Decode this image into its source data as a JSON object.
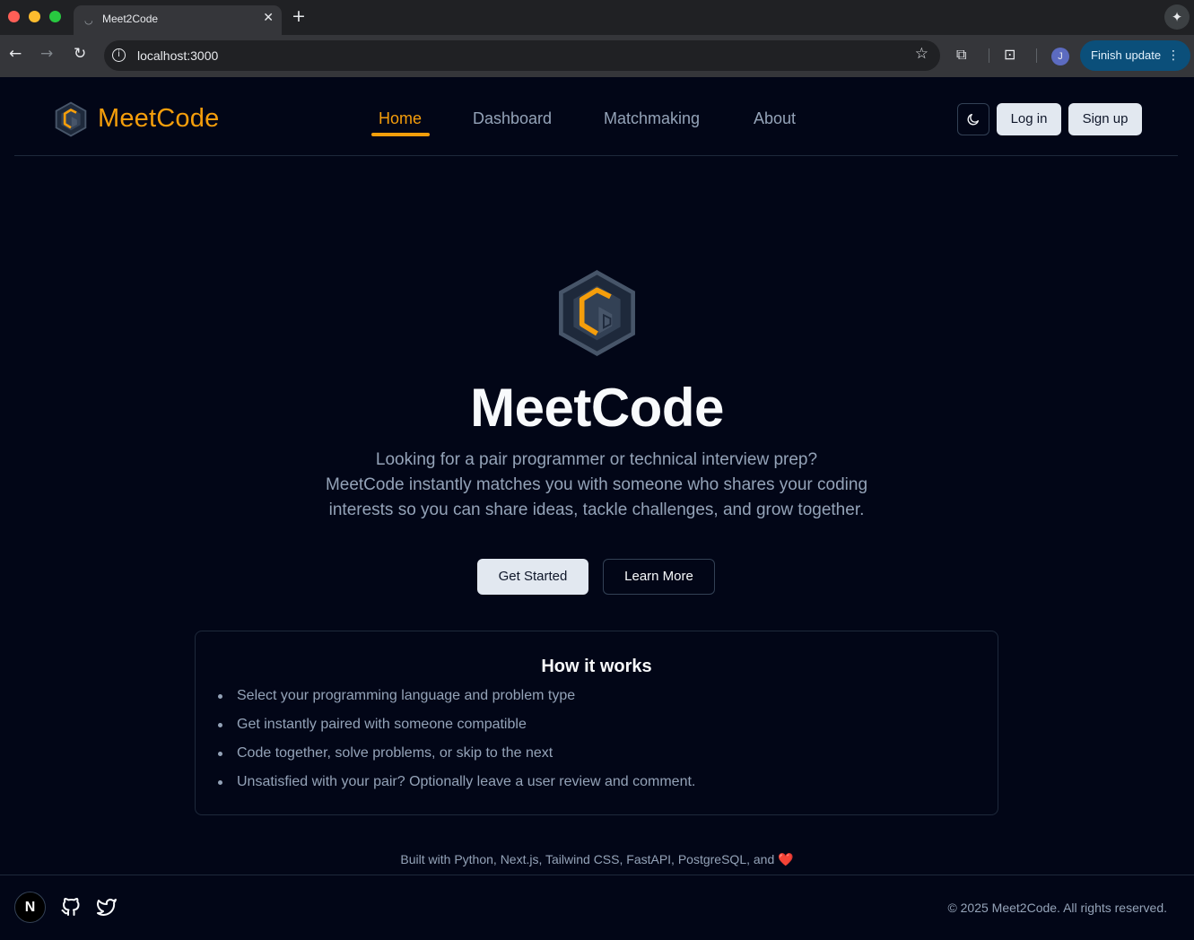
{
  "browser": {
    "tab_title": "Meet2Code",
    "tab_spinner": "◡",
    "tab_close": "✕",
    "new_tab": "+",
    "url": "localhost:3000",
    "profile_initial": "J",
    "update_label": "Finish update",
    "icons": [
      "back-arrow-icon",
      "forward-arrow-icon",
      "reload-icon",
      "info-icon",
      "star-icon",
      "extensions-icon",
      "tab-search-icon",
      "gemini-icon",
      "menu-dots-icon"
    ]
  },
  "header": {
    "brand": "MeetCode",
    "nav": [
      "Home",
      "Dashboard",
      "Matchmaking",
      "About"
    ],
    "active_nav": "Home",
    "login_label": "Log in",
    "signup_label": "Sign up",
    "theme_icon": "moon-icon"
  },
  "hero": {
    "title": "MeetCode",
    "description_lines": [
      "Looking for a pair programmer or technical interview prep?",
      "MeetCode instantly matches you with someone who shares your coding",
      "interests so you can share ideas, tackle challenges, and grow together."
    ],
    "get_started_label": "Get Started",
    "learn_more_label": "Learn More"
  },
  "how_it_works": {
    "title": "How it works",
    "items": [
      "Select your programming language and problem type",
      "Get instantly paired with someone compatible",
      "Code together, solve problems, or skip to the next",
      "Unsatisfied with your pair? Optionally leave a user review and comment."
    ]
  },
  "footer": {
    "built_with": "Built with Python, Next.js, Tailwind CSS, FastAPI, PostgreSQL, and",
    "heart": "❤️",
    "next_letter": "N",
    "copyright": "© 2025 Meet2Code. All rights reserved."
  },
  "colors": {
    "accent": "#f59e0b",
    "background": "#020617",
    "muted_text": "#94a3b8",
    "border": "#1e293b"
  }
}
